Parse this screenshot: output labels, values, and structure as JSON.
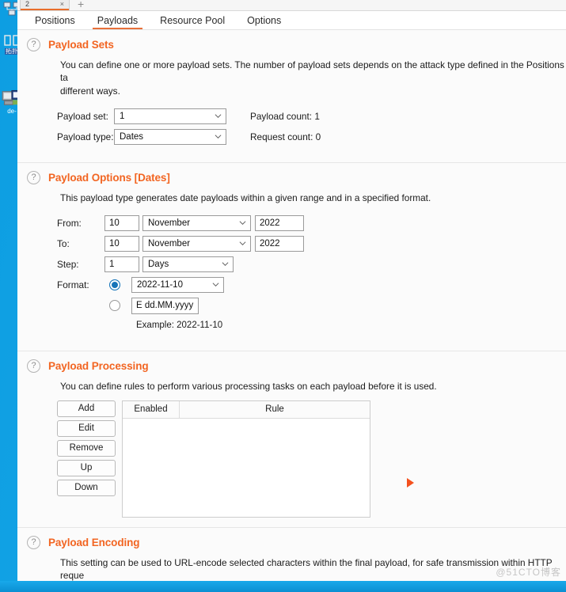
{
  "desktop": {
    "icons": [
      {
        "name": "desktop-icon-network",
        "label": ""
      },
      {
        "name": "desktop-icon-folder",
        "label": "拓扑"
      },
      {
        "name": "desktop-icon-computer",
        "label": "de-"
      }
    ]
  },
  "window": {
    "doc_tab": {
      "label": "2",
      "close": "×"
    },
    "new_tab": "+"
  },
  "nav": {
    "tabs": [
      {
        "label": "Positions",
        "active": false
      },
      {
        "label": "Payloads",
        "active": true
      },
      {
        "label": "Resource Pool",
        "active": false
      },
      {
        "label": "Options",
        "active": false
      }
    ]
  },
  "payload_sets": {
    "help": "?",
    "title": "Payload Sets",
    "description": "You can define one or more payload sets. The number of payload sets depends on the attack type defined in the Positions ta\ndifferent ways.",
    "payload_set_label": "Payload set:",
    "payload_set_value": "1",
    "payload_type_label": "Payload type:",
    "payload_type_value": "Dates",
    "payload_count": "Payload count:  1",
    "request_count": "Request count:  0"
  },
  "payload_options": {
    "help": "?",
    "title": "Payload Options [Dates]",
    "description": "This payload type generates date payloads within a given range and in a specified format.",
    "from_label": "From:",
    "from_day": "10",
    "from_month": "November",
    "from_year": "2022",
    "to_label": "To:",
    "to_day": "10",
    "to_month": "November",
    "to_year": "2022",
    "step_label": "Step:",
    "step_value": "1",
    "step_unit": "Days",
    "format_label": "Format:",
    "format_preset": "2022-11-10",
    "format_custom": "E dd.MM.yyyy",
    "example": "Example:  2022-11-10"
  },
  "payload_processing": {
    "help": "?",
    "title": "Payload Processing",
    "description": "You can define rules to perform various processing tasks on each payload before it is used.",
    "buttons": [
      "Add",
      "Edit",
      "Remove",
      "Up",
      "Down"
    ],
    "columns": [
      "Enabled",
      "Rule"
    ],
    "rows": []
  },
  "payload_encoding": {
    "help": "?",
    "title": "Payload Encoding",
    "description": "This setting can be used to URL-encode selected characters within the final payload, for safe transmission within HTTP reque"
  },
  "watermark": "@51CTO博客",
  "colors": {
    "accent": "#f26522",
    "tab_underline": "#e8703a",
    "radio_selected": "#1573b8",
    "marker": "#f4511e",
    "desktop": "#0d9ee2"
  }
}
